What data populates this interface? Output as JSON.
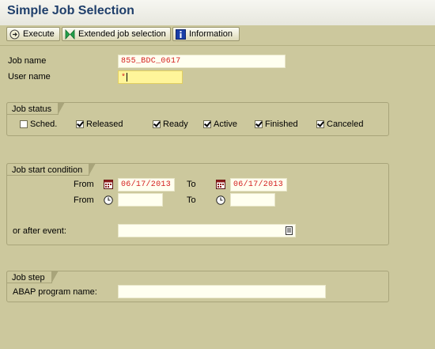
{
  "header": {
    "title": "Simple Job Selection"
  },
  "toolbar": {
    "execute": "Execute",
    "extended": "Extended job selection",
    "information": "Information"
  },
  "fields": {
    "job_name_label": "Job name",
    "job_name_value": "855_BDC_0617",
    "user_name_label": "User name",
    "user_name_value": "*"
  },
  "job_status": {
    "title": "Job status",
    "options": [
      {
        "label": "Sched.",
        "checked": false
      },
      {
        "label": "Released",
        "checked": true
      },
      {
        "label": "Ready",
        "checked": true
      },
      {
        "label": "Active",
        "checked": true
      },
      {
        "label": "Finished",
        "checked": true
      },
      {
        "label": "Canceled",
        "checked": true
      }
    ]
  },
  "start_condition": {
    "title": "Job start condition",
    "from_label": "From",
    "to_label": "To",
    "date_from": "06/17/2013",
    "date_to": "06/17/2013",
    "time_from": "",
    "time_to": "",
    "event_label": "or after event:",
    "event_value": ""
  },
  "job_step": {
    "title": "Job step",
    "program_label": "ABAP program name:",
    "program_value": ""
  }
}
